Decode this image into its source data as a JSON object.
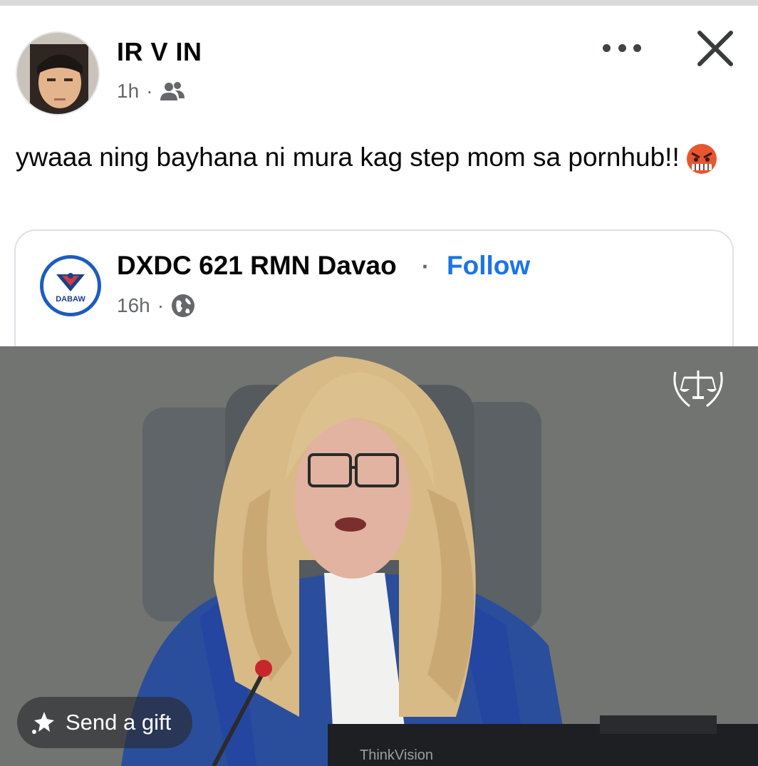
{
  "post": {
    "author": "IR V IN",
    "time": "1h",
    "separator": "·",
    "audience_icon": "friends-icon",
    "text": "ywaaa ning bayhana ni mura kag step mom sa pornhub!!",
    "emoji": "enraged-face-emoji"
  },
  "shared": {
    "page_name": "DXDC 621 RMN Davao",
    "separator": "·",
    "follow_label": "Follow",
    "time": "16h",
    "audience_icon": "globe-icon",
    "logo_text": "DABAW"
  },
  "media": {
    "gift_label": "Send a gift",
    "monitor_brand": "ThinkVision"
  },
  "colors": {
    "follow_blue": "#1b74e4",
    "meta_gray": "#65676b",
    "text": "#050505"
  }
}
